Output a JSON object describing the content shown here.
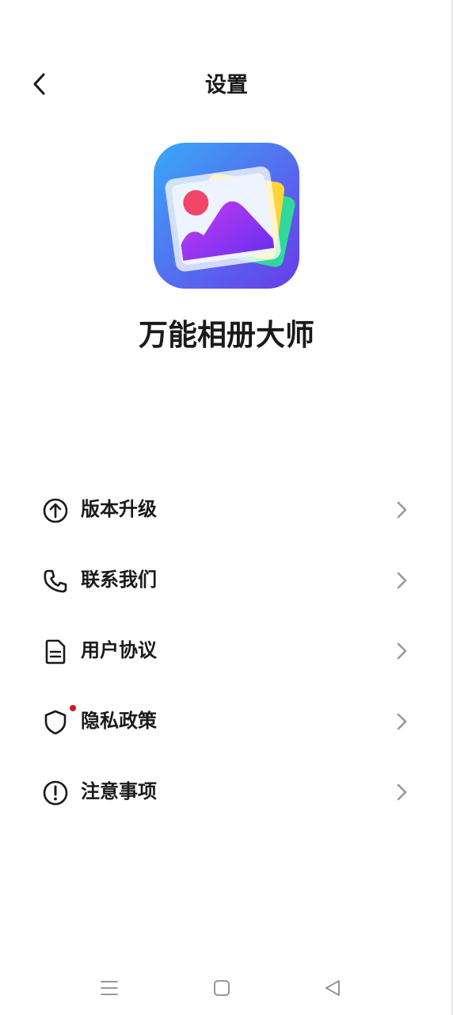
{
  "header": {
    "title": "设置",
    "back_icon": "chevron-left-icon"
  },
  "app": {
    "name": "万能相册大师",
    "icon": "photo-album-app-icon"
  },
  "menu": {
    "items": [
      {
        "label": "版本升级",
        "icon": "arrow-up-circle-icon"
      },
      {
        "label": "联系我们",
        "icon": "phone-icon"
      },
      {
        "label": "用户协议",
        "icon": "document-icon"
      },
      {
        "label": "隐私政策",
        "icon": "shield-icon",
        "badge": "red-dot"
      },
      {
        "label": "注意事项",
        "icon": "exclamation-circle-icon"
      }
    ]
  },
  "nav": {
    "items": [
      {
        "icon": "menu-lines-icon"
      },
      {
        "icon": "home-square-icon"
      },
      {
        "icon": "back-triangle-icon"
      }
    ]
  },
  "colors": {
    "text": "#1a1a1a",
    "chevron": "#9a9a9a",
    "badge": "#d11a1a",
    "icon_bg_start": "#3aa3f5",
    "icon_bg_end": "#6a3df0"
  }
}
